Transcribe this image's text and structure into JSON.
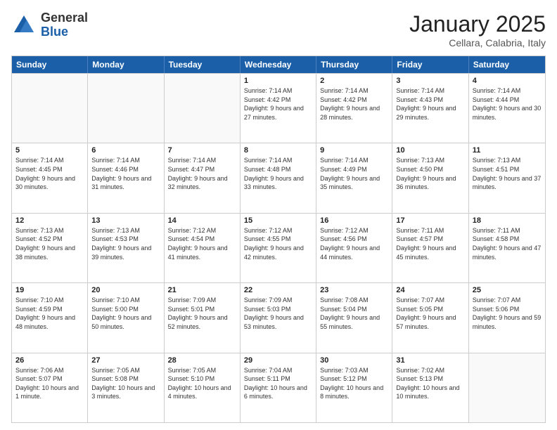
{
  "logo": {
    "general": "General",
    "blue": "Blue"
  },
  "header": {
    "month": "January 2025",
    "location": "Cellara, Calabria, Italy"
  },
  "weekdays": [
    "Sunday",
    "Monday",
    "Tuesday",
    "Wednesday",
    "Thursday",
    "Friday",
    "Saturday"
  ],
  "rows": [
    [
      {
        "day": "",
        "info": ""
      },
      {
        "day": "",
        "info": ""
      },
      {
        "day": "",
        "info": ""
      },
      {
        "day": "1",
        "info": "Sunrise: 7:14 AM\nSunset: 4:42 PM\nDaylight: 9 hours and 27 minutes."
      },
      {
        "day": "2",
        "info": "Sunrise: 7:14 AM\nSunset: 4:42 PM\nDaylight: 9 hours and 28 minutes."
      },
      {
        "day": "3",
        "info": "Sunrise: 7:14 AM\nSunset: 4:43 PM\nDaylight: 9 hours and 29 minutes."
      },
      {
        "day": "4",
        "info": "Sunrise: 7:14 AM\nSunset: 4:44 PM\nDaylight: 9 hours and 30 minutes."
      }
    ],
    [
      {
        "day": "5",
        "info": "Sunrise: 7:14 AM\nSunset: 4:45 PM\nDaylight: 9 hours and 30 minutes."
      },
      {
        "day": "6",
        "info": "Sunrise: 7:14 AM\nSunset: 4:46 PM\nDaylight: 9 hours and 31 minutes."
      },
      {
        "day": "7",
        "info": "Sunrise: 7:14 AM\nSunset: 4:47 PM\nDaylight: 9 hours and 32 minutes."
      },
      {
        "day": "8",
        "info": "Sunrise: 7:14 AM\nSunset: 4:48 PM\nDaylight: 9 hours and 33 minutes."
      },
      {
        "day": "9",
        "info": "Sunrise: 7:14 AM\nSunset: 4:49 PM\nDaylight: 9 hours and 35 minutes."
      },
      {
        "day": "10",
        "info": "Sunrise: 7:13 AM\nSunset: 4:50 PM\nDaylight: 9 hours and 36 minutes."
      },
      {
        "day": "11",
        "info": "Sunrise: 7:13 AM\nSunset: 4:51 PM\nDaylight: 9 hours and 37 minutes."
      }
    ],
    [
      {
        "day": "12",
        "info": "Sunrise: 7:13 AM\nSunset: 4:52 PM\nDaylight: 9 hours and 38 minutes."
      },
      {
        "day": "13",
        "info": "Sunrise: 7:13 AM\nSunset: 4:53 PM\nDaylight: 9 hours and 39 minutes."
      },
      {
        "day": "14",
        "info": "Sunrise: 7:12 AM\nSunset: 4:54 PM\nDaylight: 9 hours and 41 minutes."
      },
      {
        "day": "15",
        "info": "Sunrise: 7:12 AM\nSunset: 4:55 PM\nDaylight: 9 hours and 42 minutes."
      },
      {
        "day": "16",
        "info": "Sunrise: 7:12 AM\nSunset: 4:56 PM\nDaylight: 9 hours and 44 minutes."
      },
      {
        "day": "17",
        "info": "Sunrise: 7:11 AM\nSunset: 4:57 PM\nDaylight: 9 hours and 45 minutes."
      },
      {
        "day": "18",
        "info": "Sunrise: 7:11 AM\nSunset: 4:58 PM\nDaylight: 9 hours and 47 minutes."
      }
    ],
    [
      {
        "day": "19",
        "info": "Sunrise: 7:10 AM\nSunset: 4:59 PM\nDaylight: 9 hours and 48 minutes."
      },
      {
        "day": "20",
        "info": "Sunrise: 7:10 AM\nSunset: 5:00 PM\nDaylight: 9 hours and 50 minutes."
      },
      {
        "day": "21",
        "info": "Sunrise: 7:09 AM\nSunset: 5:01 PM\nDaylight: 9 hours and 52 minutes."
      },
      {
        "day": "22",
        "info": "Sunrise: 7:09 AM\nSunset: 5:03 PM\nDaylight: 9 hours and 53 minutes."
      },
      {
        "day": "23",
        "info": "Sunrise: 7:08 AM\nSunset: 5:04 PM\nDaylight: 9 hours and 55 minutes."
      },
      {
        "day": "24",
        "info": "Sunrise: 7:07 AM\nSunset: 5:05 PM\nDaylight: 9 hours and 57 minutes."
      },
      {
        "day": "25",
        "info": "Sunrise: 7:07 AM\nSunset: 5:06 PM\nDaylight: 9 hours and 59 minutes."
      }
    ],
    [
      {
        "day": "26",
        "info": "Sunrise: 7:06 AM\nSunset: 5:07 PM\nDaylight: 10 hours and 1 minute."
      },
      {
        "day": "27",
        "info": "Sunrise: 7:05 AM\nSunset: 5:08 PM\nDaylight: 10 hours and 3 minutes."
      },
      {
        "day": "28",
        "info": "Sunrise: 7:05 AM\nSunset: 5:10 PM\nDaylight: 10 hours and 4 minutes."
      },
      {
        "day": "29",
        "info": "Sunrise: 7:04 AM\nSunset: 5:11 PM\nDaylight: 10 hours and 6 minutes."
      },
      {
        "day": "30",
        "info": "Sunrise: 7:03 AM\nSunset: 5:12 PM\nDaylight: 10 hours and 8 minutes."
      },
      {
        "day": "31",
        "info": "Sunrise: 7:02 AM\nSunset: 5:13 PM\nDaylight: 10 hours and 10 minutes."
      },
      {
        "day": "",
        "info": ""
      }
    ]
  ]
}
